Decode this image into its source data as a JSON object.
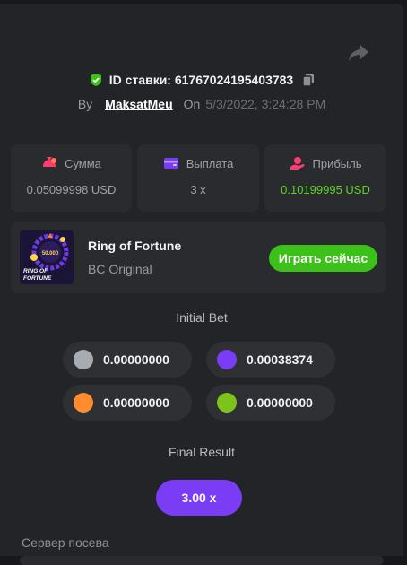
{
  "bet": {
    "id_label": "ID ставки: 61767024195403783",
    "by_label": "By",
    "username": "MaksatMeu",
    "on_label": "On",
    "datetime": "5/3/2022, 3:24:28 PM"
  },
  "stats": [
    {
      "label": "Сумма",
      "value": "0.05099998 USD",
      "icon": "money-bag-icon"
    },
    {
      "label": "Выплата",
      "value": "3 x",
      "icon": "wallet-icon"
    },
    {
      "label": "Прибыль",
      "value": "0.10199995 USD",
      "icon": "profit-hand-icon"
    }
  ],
  "game": {
    "name": "Ring of Fortune",
    "provider": "BC Original",
    "play_label": "Играть сейчас",
    "thumb_amount": "50.000",
    "thumb_title_1": "RING OF",
    "thumb_title_2": "FORTUNE"
  },
  "initial_bet": {
    "title": "Initial Bet",
    "coins": [
      {
        "color": "#a7abb2",
        "value": "0.00000000"
      },
      {
        "color": "#7b3cf5",
        "value": "0.00038374"
      },
      {
        "color": "#ff8c2e",
        "value": "0.00000000"
      },
      {
        "color": "#7ec31a",
        "value": "0.00000000"
      }
    ]
  },
  "final_result": {
    "title": "Final Result",
    "value": "3.00 x"
  },
  "server_seed": {
    "label": "Сервер посева"
  },
  "colors": {
    "accent_green": "#3bc117",
    "accent_purple": "#7b3cf5",
    "profit_green": "#5fd324",
    "panel": "#232427",
    "card": "#2a2b2f"
  }
}
